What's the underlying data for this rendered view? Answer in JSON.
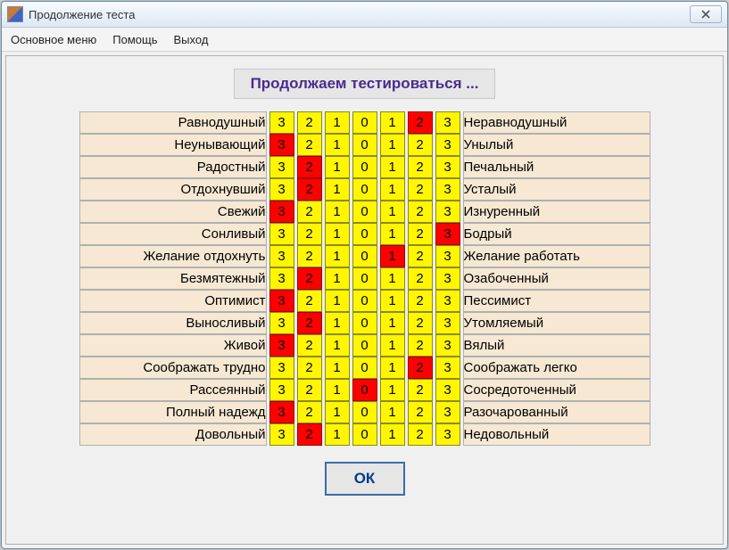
{
  "window": {
    "title": "Продолжение теста"
  },
  "menu": {
    "main": "Основное меню",
    "help": "Помощь",
    "exit": "Выход"
  },
  "banner": "Продолжаем тестироваться ...",
  "scale": [
    "3",
    "2",
    "1",
    "0",
    "1",
    "2",
    "3"
  ],
  "rows": [
    {
      "left": "Равнодушный",
      "right": "Неравнодушный",
      "selected": 5
    },
    {
      "left": "Неунывающий",
      "right": "Унылый",
      "selected": 0
    },
    {
      "left": "Радостный",
      "right": "Печальный",
      "selected": 1
    },
    {
      "left": "Отдохнувший",
      "right": "Усталый",
      "selected": 1
    },
    {
      "left": "Свежий",
      "right": "Изнуренный",
      "selected": 0
    },
    {
      "left": "Сонливый",
      "right": "Бодрый",
      "selected": 6
    },
    {
      "left": "Желание отдохнуть",
      "right": "Желание работать",
      "selected": 4
    },
    {
      "left": "Безмятежный",
      "right": "Озабоченный",
      "selected": 1
    },
    {
      "left": "Оптимист",
      "right": "Пессимист",
      "selected": 0
    },
    {
      "left": "Выносливый",
      "right": "Утомляемый",
      "selected": 1
    },
    {
      "left": "Живой",
      "right": "Вялый",
      "selected": 0
    },
    {
      "left": "Соображать трудно",
      "right": "Соображать легко",
      "selected": 5
    },
    {
      "left": "Рассеянный",
      "right": "Сосредоточенный",
      "selected": 3
    },
    {
      "left": "Полный надежд",
      "right": "Разочарованный",
      "selected": 0
    },
    {
      "left": "Довольный",
      "right": "Недовольный",
      "selected": 1
    }
  ],
  "ok_label": "ОК"
}
